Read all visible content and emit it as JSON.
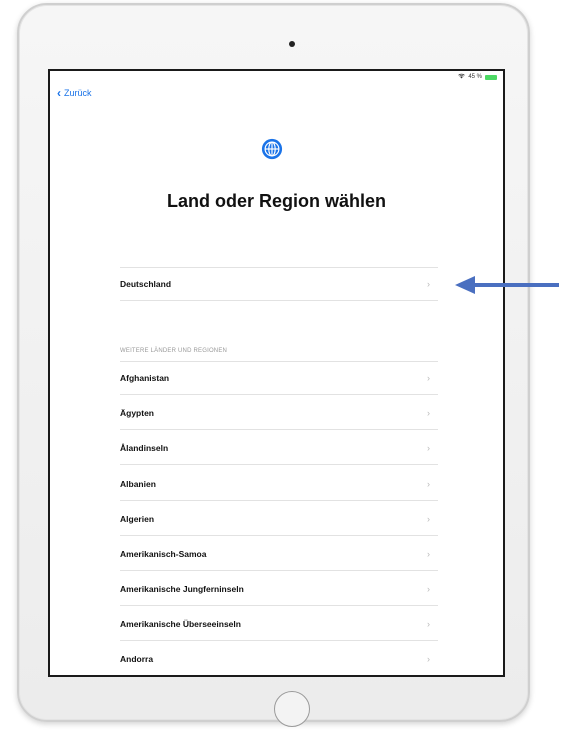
{
  "status_bar": {
    "text": "45 %"
  },
  "nav": {
    "back_label": "Zurück"
  },
  "header": {
    "icon": "globe-icon",
    "title": "Land oder Region wählen"
  },
  "selected_country": {
    "label": "Deutschland"
  },
  "other_section": {
    "header": "WEITERE LÄNDER UND REGIONEN",
    "items": [
      "Afghanistan",
      "Ägypten",
      "Ålandinseln",
      "Albanien",
      "Algerien",
      "Amerikanisch-Samoa",
      "Amerikanische Jungferninseln",
      "Amerikanische Überseeinseln",
      "Andorra"
    ]
  },
  "colors": {
    "accent": "#1a73e8",
    "annotation_arrow": "#4a6fc0",
    "battery": "#4cd964"
  }
}
